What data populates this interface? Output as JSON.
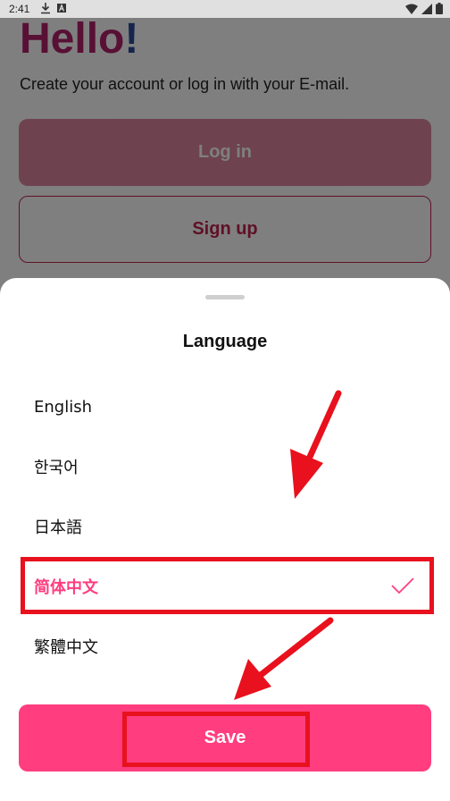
{
  "status_bar": {
    "time": "2:41"
  },
  "background": {
    "title": "Hello",
    "title_bang": "!",
    "subtitle": "Create your account or log in with your E-mail.",
    "login_label": "Log in",
    "signup_label": "Sign up"
  },
  "sheet": {
    "title": "Language",
    "languages": [
      {
        "label": "English",
        "selected": false
      },
      {
        "label": "한국어",
        "selected": false
      },
      {
        "label": "日本語",
        "selected": false
      },
      {
        "label": "简体中文",
        "selected": true
      },
      {
        "label": "繁體中文",
        "selected": false
      }
    ],
    "save_label": "Save"
  },
  "colors": {
    "accent": "#ff3d7f",
    "annotation": "#e8111d",
    "brand": "#b0206a"
  },
  "icons": [
    "download-icon",
    "accessibility-icon",
    "wifi-icon",
    "signal-icon",
    "battery-icon",
    "checkmark-icon"
  ]
}
